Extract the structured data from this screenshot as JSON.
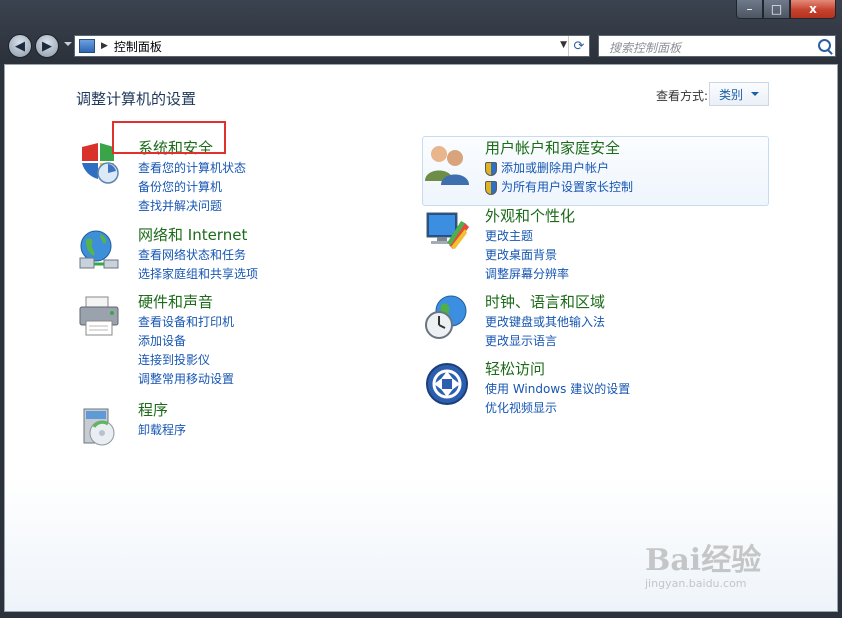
{
  "window": {
    "close_label": "x",
    "min_label": "–",
    "max_label": "□"
  },
  "nav": {
    "back_label": "◀",
    "forward_label": "▶"
  },
  "address": {
    "path": "控制面板"
  },
  "search": {
    "placeholder": "搜索控制面板"
  },
  "page": {
    "heading": "调整计算机的设置",
    "view_by_label": "查看方式:",
    "view_by_value": "类别"
  },
  "categories": {
    "system": {
      "title": "系统和安全",
      "links": [
        "查看您的计算机状态",
        "备份您的计算机",
        "查找并解决问题"
      ]
    },
    "network": {
      "title": "网络和 Internet",
      "links": [
        "查看网络状态和任务",
        "选择家庭组和共享选项"
      ]
    },
    "hardware": {
      "title": "硬件和声音",
      "links": [
        "查看设备和打印机",
        "添加设备",
        "连接到投影仪",
        "调整常用移动设置"
      ]
    },
    "programs": {
      "title": "程序",
      "links": [
        "卸载程序"
      ]
    },
    "users": {
      "title": "用户帐户和家庭安全",
      "links": [
        "添加或删除用户帐户",
        "为所有用户设置家长控制"
      ]
    },
    "appearance": {
      "title": "外观和个性化",
      "links": [
        "更改主题",
        "更改桌面背景",
        "调整屏幕分辨率"
      ]
    },
    "clock": {
      "title": "时钟、语言和区域",
      "links": [
        "更改键盘或其他输入法",
        "更改显示语言"
      ]
    },
    "ease": {
      "title": "轻松访问",
      "links": [
        "使用 Windows 建议的设置",
        "优化视频显示"
      ]
    }
  },
  "watermark": {
    "brand": "Bai经验",
    "url": "jingyan.baidu.com"
  },
  "colors": {
    "category_title": "#1c6b19",
    "link": "#1756b3",
    "highlight": "#e0312c"
  }
}
